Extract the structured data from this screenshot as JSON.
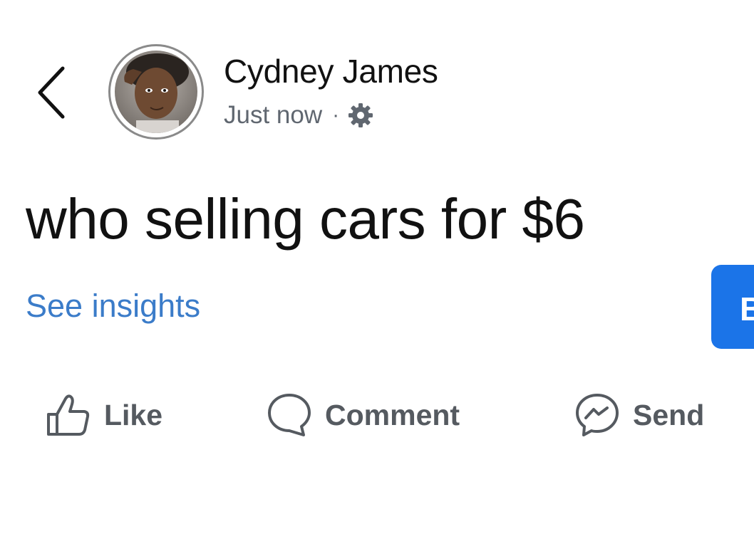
{
  "header": {
    "back_icon": "chevron-left-icon",
    "author_name": "Cydney James",
    "timestamp": "Just now",
    "separator": "·",
    "audience_icon": "gear-icon"
  },
  "post": {
    "text": "who selling cars for $6"
  },
  "links": {
    "see_insights": "See insights"
  },
  "boost_button": {
    "label_visible": "B",
    "color": "#1b74e8"
  },
  "actions": {
    "like_label": "Like",
    "comment_label": "Comment",
    "send_label": "Send",
    "like_icon": "thumbs-up-icon",
    "comment_icon": "comment-bubble-icon",
    "send_icon": "messenger-icon"
  },
  "colors": {
    "link": "#3b7cc9",
    "secondary_text": "#606770",
    "action_text": "#555a60"
  }
}
